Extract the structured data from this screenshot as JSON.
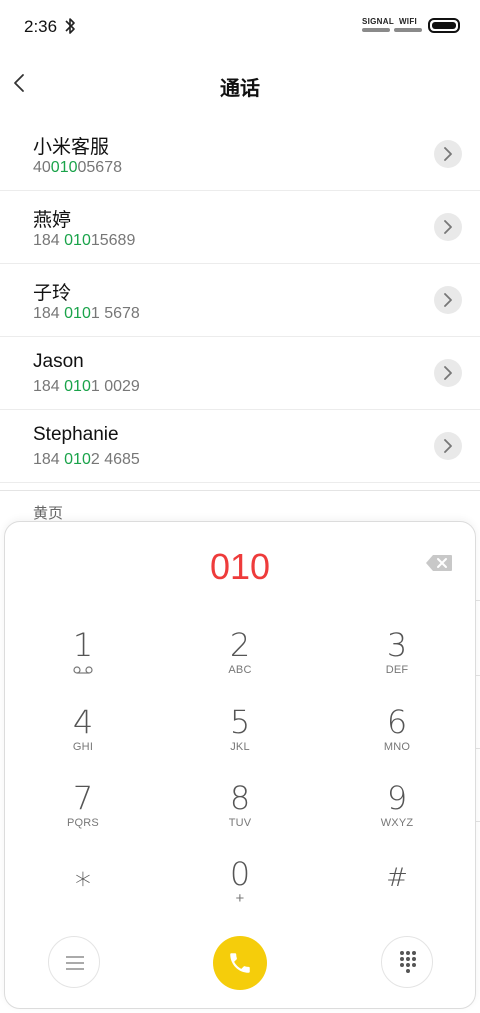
{
  "status_bar": {
    "time": "2:36",
    "signal_label": "SIGNAL",
    "wifi_label": "WIFI"
  },
  "header": {
    "title": "通话"
  },
  "contacts": [
    {
      "name": "小米客服",
      "num_pre": "40",
      "num_hl": "010",
      "num_post": "05678"
    },
    {
      "name": "燕婷",
      "num_pre": "184 ",
      "num_hl": "010",
      "num_post": "15689"
    },
    {
      "name": "子玲",
      "num_pre": "184 ",
      "num_hl": "010",
      "num_post": "1 5678"
    },
    {
      "name": "Jason",
      "num_pre": "184 ",
      "num_hl": "010",
      "num_post": "1 0029"
    },
    {
      "name": "Stephanie",
      "num_pre": "184 ",
      "num_hl": "010",
      "num_post": "2 4685"
    }
  ],
  "section_label": "黄页",
  "dialpad": {
    "entered_number": "010",
    "keys": [
      {
        "digit": "1",
        "letters": ""
      },
      {
        "digit": "2",
        "letters": "ABC"
      },
      {
        "digit": "3",
        "letters": "DEF"
      },
      {
        "digit": "4",
        "letters": "GHI"
      },
      {
        "digit": "5",
        "letters": "JKL"
      },
      {
        "digit": "6",
        "letters": "MNO"
      },
      {
        "digit": "7",
        "letters": "PQRS"
      },
      {
        "digit": "8",
        "letters": "TUV"
      },
      {
        "digit": "9",
        "letters": "WXYZ"
      },
      {
        "digit": "∗",
        "letters": ""
      },
      {
        "digit": "0",
        "letters": "+"
      },
      {
        "digit": "#",
        "letters": ""
      }
    ]
  },
  "colors": {
    "highlight": "#1aa34a",
    "entered": "#ee3b3b",
    "call_button": "#f5cd0b"
  }
}
